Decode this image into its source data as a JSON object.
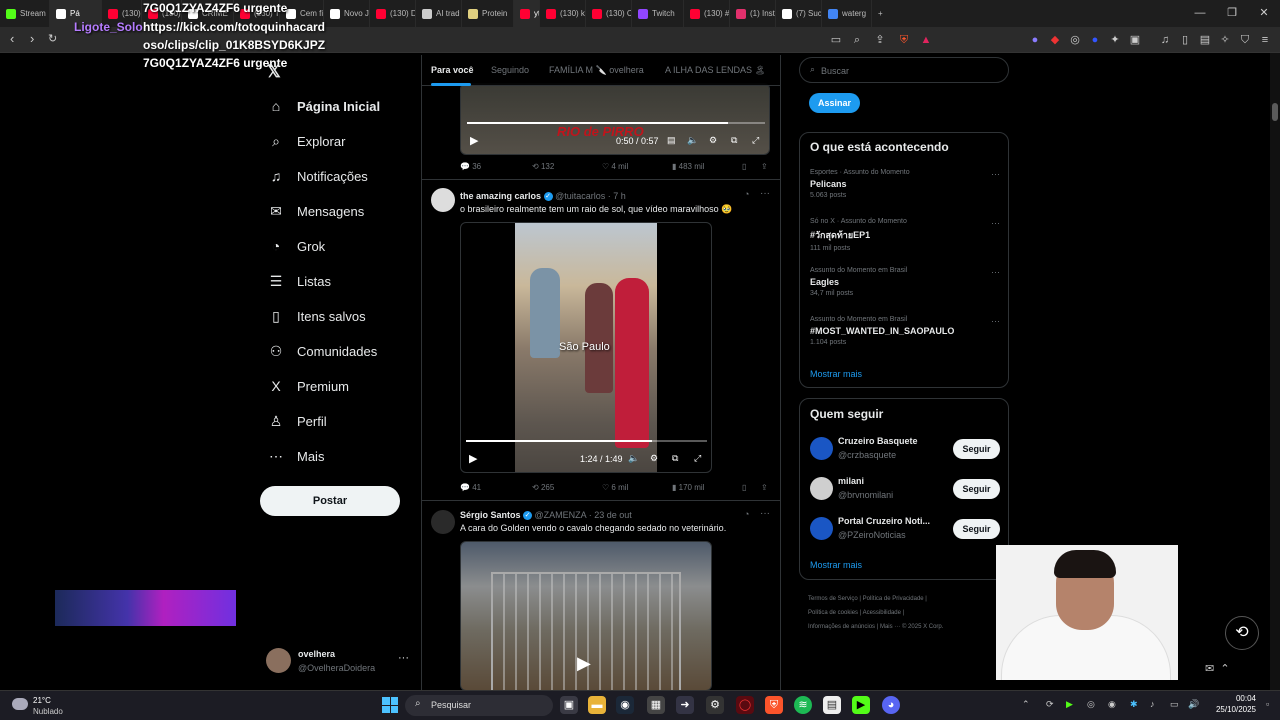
{
  "browser": {
    "tabs": [
      {
        "label": "Stream",
        "color": "#53fc18"
      },
      {
        "label": "Pá",
        "color": "#ffffff",
        "active": true
      },
      {
        "label": "(130) ",
        "color": "#ff0033"
      },
      {
        "label": "(130) ",
        "color": "#ff0033"
      },
      {
        "label": "CRIME",
        "color": "#ffffff"
      },
      {
        "label": "(130) Tr",
        "color": "#ff0033"
      },
      {
        "label": "Cem fil",
        "color": "#ffffff"
      },
      {
        "label": "Novo Ji",
        "color": "#ffffff"
      },
      {
        "label": "(130) D",
        "color": "#ff0033"
      },
      {
        "label": "AI trad",
        "color": "#cccccc"
      },
      {
        "label": "Protein",
        "color": "#e0d080"
      },
      {
        "label": "ytb",
        "color": "#ff0033",
        "active": true
      },
      {
        "label": "(130) k",
        "color": "#ff0033"
      },
      {
        "label": "(130) C",
        "color": "#ff0033"
      },
      {
        "label": "Twitch",
        "color": "#9146ff"
      },
      {
        "label": "(130) #",
        "color": "#ff0033"
      },
      {
        "label": "(1) Inst",
        "color": "#e1306c"
      },
      {
        "label": "(7) Suc",
        "color": "#ffffff"
      },
      {
        "label": "waterg",
        "color": "#4285f4"
      }
    ],
    "new_tab": "+",
    "window_controls": [
      "—",
      "❐",
      "✕"
    ]
  },
  "overlay": {
    "line1": "7G0Q1ZYAZ4ZF6 urgente",
    "user": "Ligote_Solo",
    "line2": "https://kick.com/totoquinhacard",
    "line3": "oso/clips/clip_01K8BSYD6KJPZ",
    "line4": "7G0Q1ZYAZ4ZF6 urgente"
  },
  "nav": {
    "items": [
      {
        "label": "Página Inicial",
        "icon": "⌂"
      },
      {
        "label": "Explorar",
        "icon": "⌕"
      },
      {
        "label": "Notificações",
        "icon": "♫"
      },
      {
        "label": "Mensagens",
        "icon": "✉"
      },
      {
        "label": "Grok",
        "icon": "◔"
      },
      {
        "label": "Listas",
        "icon": "☰"
      },
      {
        "label": "Itens salvos",
        "icon": "▯"
      },
      {
        "label": "Comunidades",
        "icon": "⚇"
      },
      {
        "label": "Premium",
        "icon": "X"
      },
      {
        "label": "Perfil",
        "icon": "♙"
      },
      {
        "label": "Mais",
        "icon": "⋯"
      }
    ],
    "post_button": "Postar",
    "profile": {
      "name": "ovelhera",
      "handle": "@OvelheraDoidera",
      "more": "···"
    }
  },
  "feed": {
    "tabs": [
      "Para você",
      "Seguindo",
      "FAMÍLIA M 🔪 ovelhera",
      "A ILHA DAS LENDAS 🏝"
    ],
    "top_video": {
      "time": "0:50 / 0:57",
      "progress": 0.877,
      "title_overlay": "RIO de PIRRO"
    },
    "top_actions": {
      "replies": "36",
      "reposts": "132",
      "likes": "4 mil",
      "views": "483 mil"
    },
    "tweets": [
      {
        "name": "the amazing carlos",
        "handle": "@tuitacarlos",
        "time": "· 7 h",
        "text": "o brasileiro realmente tem um raio de sol, que vídeo maravilhoso 🥹",
        "video_caption": "São Paulo",
        "video_time": "1:24 / 1:49",
        "video_progress": 0.77,
        "replies": "41",
        "reposts": "265",
        "likes": "6 mil",
        "views": "170 mil"
      },
      {
        "name": "Sérgio Santos",
        "handle": "@ZAMENZA",
        "time": "· 23 de out",
        "text": "A cara do Golden vendo o cavalo chegando sedado no veterinário."
      }
    ]
  },
  "right": {
    "search_placeholder": "Buscar",
    "subscribe": "Assinar",
    "trending_title": "O que está acontecendo",
    "trends": [
      {
        "context": "Esportes · Assunto do Momento",
        "name": "Pelicans",
        "count": "5.063 posts"
      },
      {
        "context": "Só no X · Assunto do Momento",
        "name": "#วักสุดท้ายEP1",
        "count": "111 mil posts"
      },
      {
        "context": "Assunto do Momento em Brasil",
        "name": "Eagles",
        "count": "34,7 mil posts"
      },
      {
        "context": "Assunto do Momento em Brasil",
        "name": "#MOST_WANTED_IN_SAOPAULO",
        "count": "1.104 posts"
      }
    ],
    "show_more": "Mostrar mais",
    "who_title": "Quem seguir",
    "who": [
      {
        "name": "Cruzeiro Basquete",
        "handle": "@crzbasquete",
        "btn": "Seguir",
        "color": "#1a56c4"
      },
      {
        "name": "milani",
        "handle": "@brvnomilani",
        "btn": "Seguir",
        "color": "#cfcfcf"
      },
      {
        "name": "Portal Cruzeiro Noti...",
        "handle": "@PZeiroNoticias",
        "btn": "Seguir",
        "color": "#1a56c4"
      }
    ],
    "who_more": "Mostrar mais",
    "footer": [
      "Termos de Serviço",
      "Política de Privacidade",
      "Política de cookies",
      "Acessibilidade",
      "Informações de anúncios",
      "Mais ···",
      "© 2025 X Corp."
    ]
  },
  "taskbar": {
    "weather_temp": "21°C",
    "weather_desc": "Nublado",
    "search_placeholder": "Pesquisar",
    "time": "00:04",
    "date": "25/10/2025"
  },
  "colors": {
    "accent": "#1d9bf0",
    "bg": "#000000",
    "border": "#2f3336"
  }
}
